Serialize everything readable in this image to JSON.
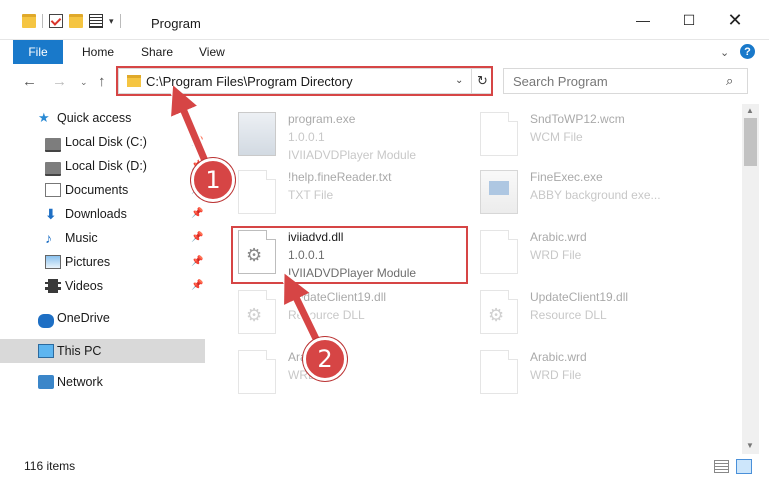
{
  "window": {
    "title": "Program",
    "minimize": "—",
    "maximize": "☐",
    "close": "✕"
  },
  "ribbon": {
    "tabs": [
      "File",
      "Home",
      "Share",
      "View"
    ],
    "expand": "⌄",
    "help": "?"
  },
  "nav": {
    "back": "←",
    "forward": "→",
    "recent": "⌄",
    "up": "↑",
    "address": "C:\\Program Files\\Program Directory",
    "address_dropdown": "⌄",
    "refresh": "↻",
    "search_placeholder": "Search Program",
    "search_icon": "⌕"
  },
  "sidebar": {
    "items": [
      {
        "label": "Quick access",
        "icon": "star-icon"
      },
      {
        "label": "Local Disk (C:)",
        "icon": "disk-icon",
        "pinned": true
      },
      {
        "label": "Local Disk (D:)",
        "icon": "disk-icon",
        "pinned": true
      },
      {
        "label": "Documents",
        "icon": "documents-icon",
        "pinned": true
      },
      {
        "label": "Downloads",
        "icon": "downloads-icon",
        "pinned": true
      },
      {
        "label": "Music",
        "icon": "music-icon",
        "pinned": true
      },
      {
        "label": "Pictures",
        "icon": "pictures-icon",
        "pinned": true
      },
      {
        "label": "Videos",
        "icon": "videos-icon",
        "pinned": true
      },
      {
        "label": "OneDrive",
        "icon": "onedrive-icon"
      },
      {
        "label": "This PC",
        "icon": "this-pc-icon",
        "selected": true
      },
      {
        "label": "Network",
        "icon": "network-icon"
      }
    ],
    "pin_glyph": "📌"
  },
  "files": [
    {
      "name": "program.exe",
      "line1": "1.0.0.1",
      "line2": "IVIIADVDPlayer Module",
      "icon": "exe-icon",
      "faded": true
    },
    {
      "name": "SndToWP12.wcm",
      "line1": "WCM File",
      "line2": "",
      "icon": "file-icon",
      "faded": true
    },
    {
      "name": "!help.fineReader.txt",
      "line1": "TXT File",
      "line2": "",
      "icon": "file-icon",
      "faded": true
    },
    {
      "name": "FineExec.exe",
      "line1": "ABBY background exe...",
      "line2": "",
      "icon": "finereader-icon",
      "faded": true
    },
    {
      "name": "iviiadvd.dll",
      "line1": "1.0.0.1",
      "line2": "IVIIADVDPlayer Module",
      "icon": "dll-gear-icon",
      "faded": false
    },
    {
      "name": "Arabic.wrd",
      "line1": "WRD File",
      "line2": "",
      "icon": "file-icon",
      "faded": true
    },
    {
      "name": "UpdateClient19.dll",
      "line1": "Resource DLL",
      "line2": "",
      "icon": "dll-gear-icon",
      "faded": true
    },
    {
      "name": "UpdateClient19.dll",
      "line1": "Resource DLL",
      "line2": "",
      "icon": "dll-gear-icon",
      "faded": true
    },
    {
      "name": "Arabic.wrd",
      "line1": "WRD File",
      "line2": "",
      "icon": "file-icon",
      "faded": true
    },
    {
      "name": "Arabic.wrd",
      "line1": "WRD File",
      "line2": "",
      "icon": "file-icon",
      "faded": true
    }
  ],
  "status": {
    "item_count": "116 items"
  },
  "callouts": [
    "1",
    "2"
  ],
  "colors": {
    "accent": "#1979ca",
    "highlight": "#d64545"
  }
}
